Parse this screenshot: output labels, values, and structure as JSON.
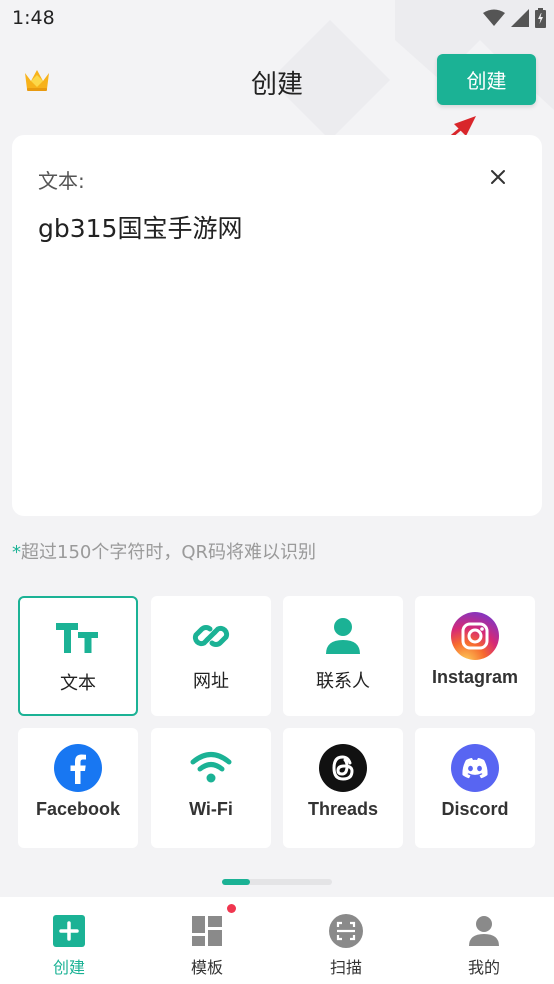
{
  "status_bar": {
    "time": "1:48"
  },
  "header": {
    "title": "创建",
    "create_button": "创建"
  },
  "editor": {
    "label": "文本:",
    "value": "gb315国宝手游网"
  },
  "hint": {
    "star": "*",
    "text": "超过150个字符时，QR码将难以识别"
  },
  "types": [
    {
      "label": "文本",
      "icon": "text-icon"
    },
    {
      "label": "网址",
      "icon": "link-icon"
    },
    {
      "label": "联系人",
      "icon": "contact-icon"
    },
    {
      "label": "Instagram",
      "icon": "instagram-icon"
    },
    {
      "label": "Facebook",
      "icon": "facebook-icon"
    },
    {
      "label": "Wi-Fi",
      "icon": "wifi-icon"
    },
    {
      "label": "Threads",
      "icon": "threads-icon"
    },
    {
      "label": "Discord",
      "icon": "discord-icon"
    }
  ],
  "pager": {
    "pages": 4,
    "current": 1
  },
  "bottom_nav": [
    {
      "label": "创建",
      "icon": "plus-square-icon",
      "active": true
    },
    {
      "label": "模板",
      "icon": "grid-icon",
      "badge": true
    },
    {
      "label": "扫描",
      "icon": "scan-icon"
    },
    {
      "label": "我的",
      "icon": "profile-icon"
    }
  ],
  "colors": {
    "accent": "#1bb295",
    "background": "#f3f3f5",
    "badge": "#f0364f",
    "annotation_arrow": "#d9262b"
  }
}
